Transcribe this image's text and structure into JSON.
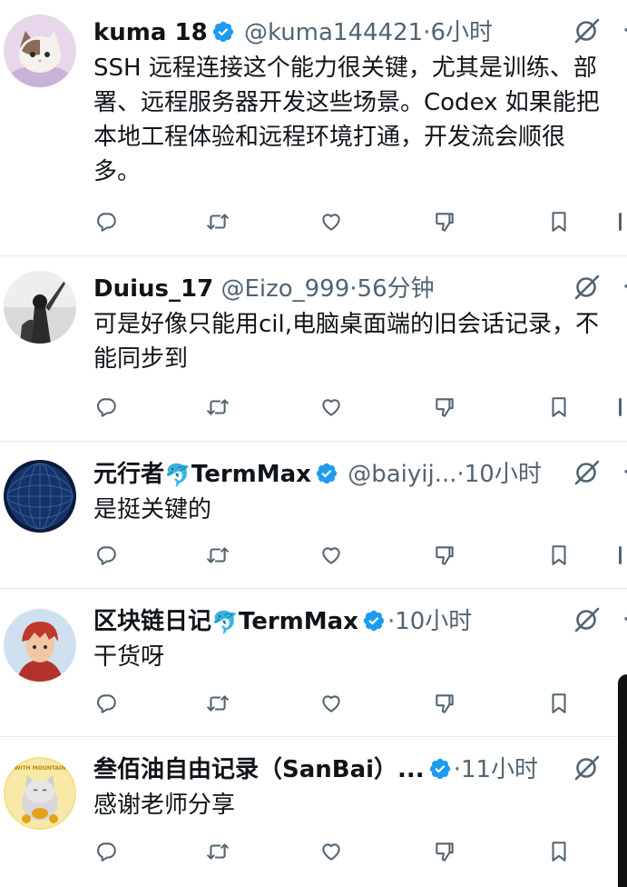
{
  "tweets": [
    {
      "name": "kuma 18",
      "verified": true,
      "handle": "@kuma144421",
      "sep": "·",
      "time": "6小时",
      "body": "SSH 远程连接这个能力很关键，尤其是训练、部\n署、远程服务器开发这些场景。Codex 如果能把\n本地工程体验和远程环境打通，开发流会顺很\n多。",
      "avatar": "cat-avatar"
    },
    {
      "name": "Duius_17",
      "verified": false,
      "handle": "@Eizo_999",
      "sep": "·",
      "time": "56分钟",
      "body": "可是好像只能用cil,电脑桌面端的旧会话记录，不\n能同步到",
      "avatar": "knight-avatar"
    },
    {
      "name": "元行者",
      "emoji": "🐬",
      "name2": "TermMax",
      "verified": true,
      "handle": "@baiyij...",
      "sep": "·",
      "time": "10小时",
      "body": "是挺关键的",
      "avatar": "globe-avatar"
    },
    {
      "name": "区块链日记",
      "emoji": "🐬",
      "name2": "TermMax",
      "verified": true,
      "handle": "",
      "sep": "·",
      "time": "10小时",
      "body": "干货呀",
      "avatar": "anime-avatar"
    },
    {
      "name": "叁佰油自由记录（SanBai）...",
      "verified": true,
      "handle": "",
      "sep": "·",
      "time": "11小时",
      "body": "感谢老师分享",
      "avatar": "lucky-cat-avatar"
    }
  ],
  "colors": {
    "verified": "#1d9bf0",
    "icon": "#536471",
    "text": "#0f1419",
    "divider": "#e6e9eb"
  },
  "icons": [
    "reply-icon",
    "retweet-icon",
    "like-icon",
    "dislike-icon",
    "bookmark-icon",
    "grok-icon",
    "more-icon"
  ],
  "more_label": "·",
  "avatar_badge_text": "WITH MOUNTAIN"
}
